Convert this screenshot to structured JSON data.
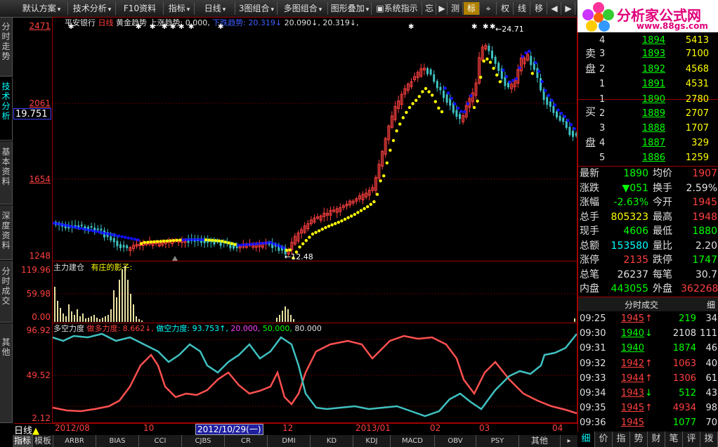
{
  "toolbar": {
    "buttons": [
      "默认方案",
      "技术分析",
      "F10资料",
      "指标",
      "日线",
      "3图组合",
      "多图组合",
      "图形叠加",
      "系统指示",
      "忘",
      "测",
      "标",
      "权",
      "线",
      "移"
    ],
    "selected": "标"
  },
  "logo": {
    "title": "分析家公式网",
    "url": "www.88gs.com"
  },
  "side_tabs": [
    "分时走势",
    "技术分析",
    "基本资料",
    "深度资料",
    "分时成交",
    "其他"
  ],
  "main_chart": {
    "header": {
      "stock": "平安银行",
      "period": "日线",
      "indicator": "黄金趋势",
      "up_label": "上涨趋势: 0.000,",
      "down_label": "下跌趋势: 20.319↓",
      "v1": "20.090↓,",
      "v2": "20.319↓,"
    },
    "y_labels": [
      "2471",
      "2061",
      "1654",
      "1248"
    ],
    "cursor_price": "19.751",
    "high_label": "←24.71",
    "low_label": "←12.48"
  },
  "vol_chart": {
    "header": {
      "name": "主力建仓",
      "sub": "有庄的影子:"
    },
    "y_labels": [
      "119.96",
      "59.98",
      "0.00"
    ]
  },
  "osc_chart": {
    "header": {
      "name": "多空力度",
      "bull": "做多力度: 8.662↓,",
      "bear": "做空力度: 93.753↑,",
      "l1": "20.000,",
      "l2": "50.000,",
      "l3": "80.000"
    },
    "y_labels": [
      "96.92",
      "49.52",
      "2.12"
    ]
  },
  "x_axis": {
    "period": "日线",
    "labels": [
      "2012/08",
      "10",
      "2012/10/29(一)",
      "12",
      "2013/01",
      "02",
      "03",
      "04"
    ]
  },
  "bottom_tabs": [
    "指标",
    "模板",
    "ARBR",
    "BIAS",
    "CCI",
    "CJBS",
    "CR",
    "DMI",
    "KD",
    "KDJ",
    "MACD",
    "OBV",
    "PSY",
    "其他"
  ],
  "order_book": {
    "sell": [
      {
        "label": "",
        "lvl": "4",
        "price": "1894",
        "vol": "5413"
      },
      {
        "label": "卖",
        "lvl": "3",
        "price": "1893",
        "vol": "7100"
      },
      {
        "label": "盘",
        "lvl": "2",
        "price": "1892",
        "vol": "4568"
      },
      {
        "label": "",
        "lvl": "1",
        "price": "1891",
        "vol": "4531"
      }
    ],
    "buy": [
      {
        "label": "买",
        "lvl": "1",
        "price": "1890",
        "vol": "2780"
      },
      {
        "label": "",
        "lvl": "2",
        "price": "1889",
        "vol": "2707"
      },
      {
        "label": "",
        "lvl": "3",
        "price": "1888",
        "vol": "1707"
      },
      {
        "label": "盘",
        "lvl": "4",
        "price": "1887",
        "vol": "329"
      },
      {
        "label": "",
        "lvl": "5",
        "price": "1886",
        "vol": "1259"
      }
    ]
  },
  "quote": [
    {
      "k1": "最新",
      "v1": "1890",
      "c1": "g",
      "k2": "均价",
      "v2": "1907",
      "c2": "r"
    },
    {
      "k1": "涨跌",
      "v1": "▼051",
      "c1": "g",
      "k2": "换手",
      "v2": "2.59%",
      "c2": "w"
    },
    {
      "k1": "涨幅",
      "v1": "-2.63%",
      "c1": "g",
      "k2": "今开",
      "v2": "1945",
      "c2": "r"
    },
    {
      "k1": "总手",
      "v1": "805323",
      "c1": "y",
      "k2": "最高",
      "v2": "1948",
      "c2": "r"
    },
    {
      "k1": "现手",
      "v1": "4606",
      "c1": "g",
      "k2": "最低",
      "v2": "1880",
      "c2": "g"
    },
    {
      "k1": "总额",
      "v1": "153580",
      "c1": "c",
      "k2": "量比",
      "v2": "2.20",
      "c2": "w"
    },
    {
      "k1": "涨停",
      "v1": "2135",
      "c1": "r",
      "k2": "跌停",
      "v2": "1747",
      "c2": "g"
    },
    {
      "k1": "总笔",
      "v1": "26237",
      "c1": "w",
      "k2": "每笔",
      "v2": "30.7",
      "c2": "w"
    },
    {
      "k1": "内盘",
      "v1": "443055",
      "c1": "g",
      "k2": "外盘",
      "v2": "362268",
      "c2": "r"
    }
  ],
  "trades": {
    "title": "分时成交",
    "detail": "细",
    "rows": [
      {
        "t": "09:25",
        "p": "1945",
        "pc": "r",
        "a": "↑",
        "ac": "r",
        "v": "219",
        "vc": "g",
        "n": "34"
      },
      {
        "t": "09:30",
        "p": "1940",
        "pc": "g",
        "a": "↓",
        "ac": "g",
        "v": "2108",
        "vc": "w",
        "n": "111"
      },
      {
        "t": "09:31",
        "p": "1940",
        "pc": "g",
        "a": "",
        "ac": "g",
        "v": "1874",
        "vc": "g",
        "n": "46"
      },
      {
        "t": "09:32",
        "p": "1942",
        "pc": "r",
        "a": "↑",
        "ac": "r",
        "v": "1063",
        "vc": "r",
        "n": "40"
      },
      {
        "t": "09:33",
        "p": "1944",
        "pc": "r",
        "a": "↑",
        "ac": "r",
        "v": "1306",
        "vc": "r",
        "n": "61"
      },
      {
        "t": "09:34",
        "p": "1943",
        "pc": "r",
        "a": "↓",
        "ac": "g",
        "v": "512",
        "vc": "g",
        "n": "43"
      },
      {
        "t": "09:35",
        "p": "1945",
        "pc": "r",
        "a": "↑",
        "ac": "r",
        "v": "4934",
        "vc": "r",
        "n": "98"
      },
      {
        "t": "09:36",
        "p": "1945",
        "pc": "r",
        "a": "",
        "ac": "r",
        "v": "1077",
        "vc": "g",
        "n": "70"
      }
    ]
  },
  "right_tabs": [
    "细",
    "价",
    "指",
    "势",
    "财",
    "笔",
    "评",
    "拨"
  ],
  "colors": {
    "up": "#ff4040",
    "down": "#00ffff",
    "trend_up": "#ffff00",
    "trend_down": "#0000ff",
    "frame": "#a00000"
  }
}
